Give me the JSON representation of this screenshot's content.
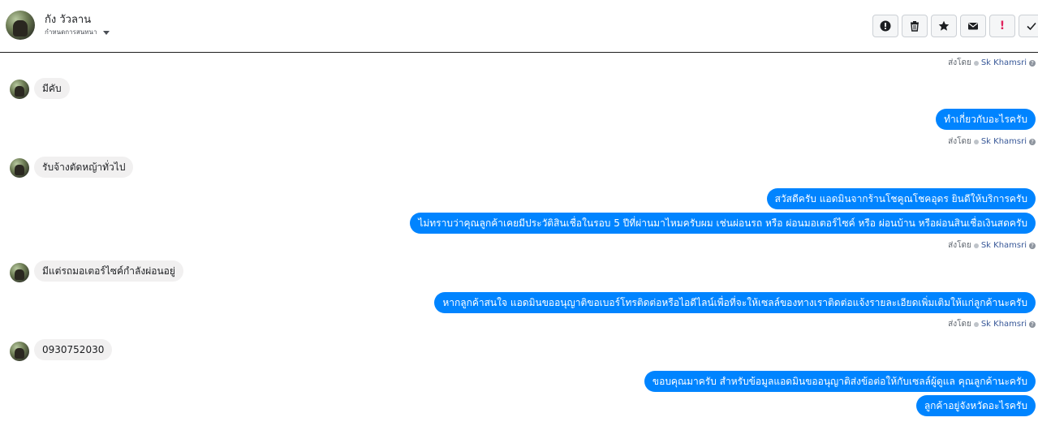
{
  "header": {
    "contact_name": "กัง วัวลาน",
    "assign_label": "กำหนดการสนทนา"
  },
  "toolbar": {
    "buttons": [
      {
        "name": "report-button",
        "icon": "alert-circle-icon"
      },
      {
        "name": "delete-button",
        "icon": "trash-icon"
      },
      {
        "name": "star-button",
        "icon": "star-icon"
      },
      {
        "name": "mark-unread-button",
        "icon": "envelope-icon"
      },
      {
        "name": "spam-button",
        "icon": "exclamation-icon",
        "label": "!"
      },
      {
        "name": "done-button",
        "icon": "checkmark-icon"
      }
    ]
  },
  "colors": {
    "outgoing_bubble": "#0084ff",
    "incoming_bubble": "#f1f0f0",
    "sender_link": "#385898"
  },
  "sender_note": {
    "sent_by": "ส่งโดย",
    "sender": "Sk Khamsri",
    "help": "?"
  },
  "messages": [
    {
      "dir": "in",
      "text": "มีคับ"
    },
    {
      "dir": "out",
      "text": "ทำเกี่ยวกับอะไรครับ"
    },
    {
      "dir": "in",
      "text": "รับจ้างตัดหญ้าทั่วไป"
    },
    {
      "dir": "out",
      "text": "สวัสดีครับ แอดมินจากร้านโชคูณโชคอุดร ยินดีให้บริการครับ"
    },
    {
      "dir": "out",
      "text": "ไม่ทราบว่าคุณลูกค้าเคยมีประวัติสินเชื่อในรอบ 5 ปีที่ผ่านมาไหมครับผม เช่นผ่อนรถ หรือ ผ่อนมอเตอร์ไซค์ หรือ ผ่อนบ้าน หรือผ่อนสินเชื่อเงินสดครับ"
    },
    {
      "dir": "in",
      "text": "มีแต่รถมอเตอร์ไซค์กำลังผ่อนอยู่"
    },
    {
      "dir": "out",
      "text": "หากลูกค้าสนใจ แอดมินขออนุญาติขอเบอร์โทรติดต่อหรือไอดีไลน์เพื่อที่จะให้เซลล์ของทางเราติดต่อแจ้งรายละเอียดเพิ่มเติมให้แก่ลูกค้านะครับ"
    },
    {
      "dir": "in",
      "text": "0930752030"
    },
    {
      "dir": "out",
      "text": "ขอบคุณมาครับ สำหรับข้อมูลแอดมินขออนุญาติส่งข้อต่อให้กับเซลล์ผู้ดูแล คุณลูกค้านะครับ"
    },
    {
      "dir": "out",
      "text": "ลูกค้าอยู่จังหวัดอะไรครับ"
    }
  ]
}
